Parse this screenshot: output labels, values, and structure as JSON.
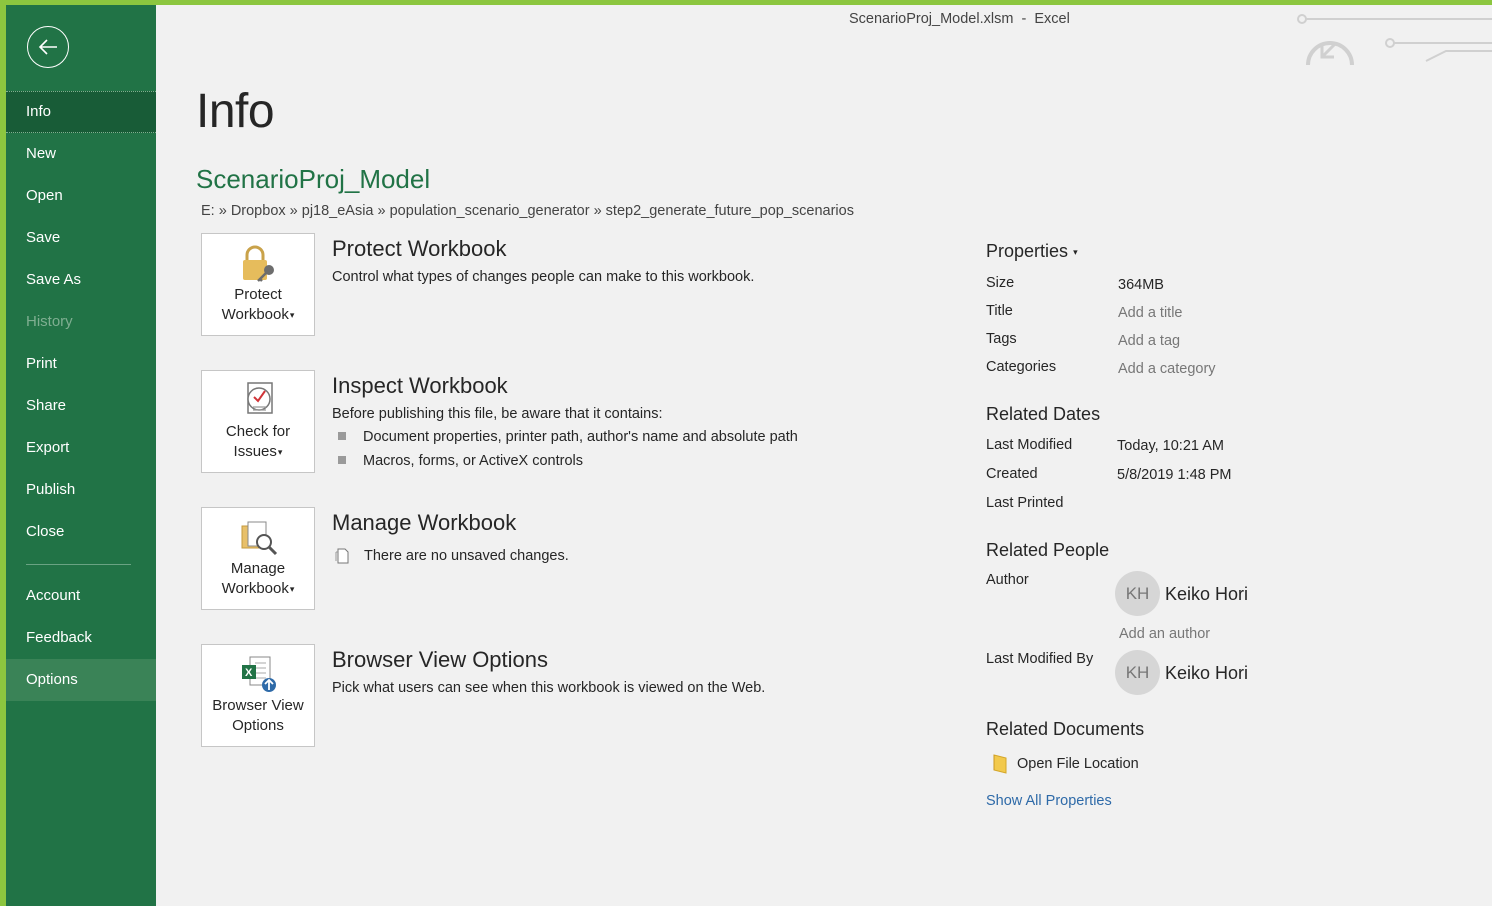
{
  "window": {
    "title": "ScenarioProj_Model.xlsm  -  Excel"
  },
  "colors": {
    "accent": "#217346",
    "sidebar": "#217346",
    "sidebar_active": "#185c37",
    "frame": "#8cc63f",
    "link": "#2e6aa8"
  },
  "sidebar": {
    "back_icon": "back-arrow-icon",
    "items": [
      {
        "label": "Info",
        "state": "active"
      },
      {
        "label": "New"
      },
      {
        "label": "Open"
      },
      {
        "label": "Save"
      },
      {
        "label": "Save As"
      },
      {
        "label": "History",
        "state": "disabled"
      },
      {
        "label": "Print"
      },
      {
        "label": "Share"
      },
      {
        "label": "Export"
      },
      {
        "label": "Publish"
      },
      {
        "label": "Close"
      },
      {
        "label": "Account"
      },
      {
        "label": "Feedback"
      },
      {
        "label": "Options",
        "state": "hover"
      }
    ]
  },
  "main": {
    "title": "Info",
    "file_name": "ScenarioProj_Model",
    "path": "E: » Dropbox » pj18_eAsia » population_scenario_generator » step2_generate_future_pop_scenarios",
    "sections": [
      {
        "button_line1": "Protect",
        "button_line2": "Workbook",
        "icon": "lock-key-icon",
        "title": "Protect Workbook",
        "description": "Control what types of changes people can make to this workbook."
      },
      {
        "button_line1": "Check for",
        "button_line2": "Issues",
        "icon": "checklist-icon",
        "title": "Inspect Workbook",
        "description": "Before publishing this file, be aware that it contains:",
        "bullets": [
          "Document properties, printer path, author's name and absolute path",
          "Macros, forms, or ActiveX controls"
        ]
      },
      {
        "button_line1": "Manage",
        "button_line2": "Workbook",
        "icon": "manage-workbook-icon",
        "title": "Manage Workbook",
        "note": "There are no unsaved changes."
      },
      {
        "button_line1": "Browser View",
        "button_line2": "Options",
        "icon": "excel-web-icon",
        "title": "Browser View Options",
        "description": "Pick what users can see when this workbook is viewed on the Web."
      }
    ]
  },
  "properties": {
    "heading": "Properties",
    "rows": [
      {
        "label": "Size",
        "value": "364MB"
      },
      {
        "label": "Title",
        "value": "Add a title"
      },
      {
        "label": "Tags",
        "value": "Add a tag"
      },
      {
        "label": "Categories",
        "value": "Add a category"
      }
    ],
    "related_dates": {
      "heading": "Related Dates",
      "rows": [
        {
          "label": "Last Modified",
          "value": "Today, 10:21 AM"
        },
        {
          "label": "Created",
          "value": "5/8/2019 1:48 PM"
        },
        {
          "label": "Last Printed",
          "value": ""
        }
      ]
    },
    "related_people": {
      "heading": "Related People",
      "author_label": "Author",
      "author_initials": "KH",
      "author_name": "Keiko Hori",
      "add_author": "Add an author",
      "modified_by_label": "Last Modified By",
      "modified_by_initials": "KH",
      "modified_by_name": "Keiko Hori"
    },
    "related_documents": {
      "heading": "Related Documents",
      "open_location": "Open File Location"
    },
    "show_all": "Show All Properties"
  }
}
